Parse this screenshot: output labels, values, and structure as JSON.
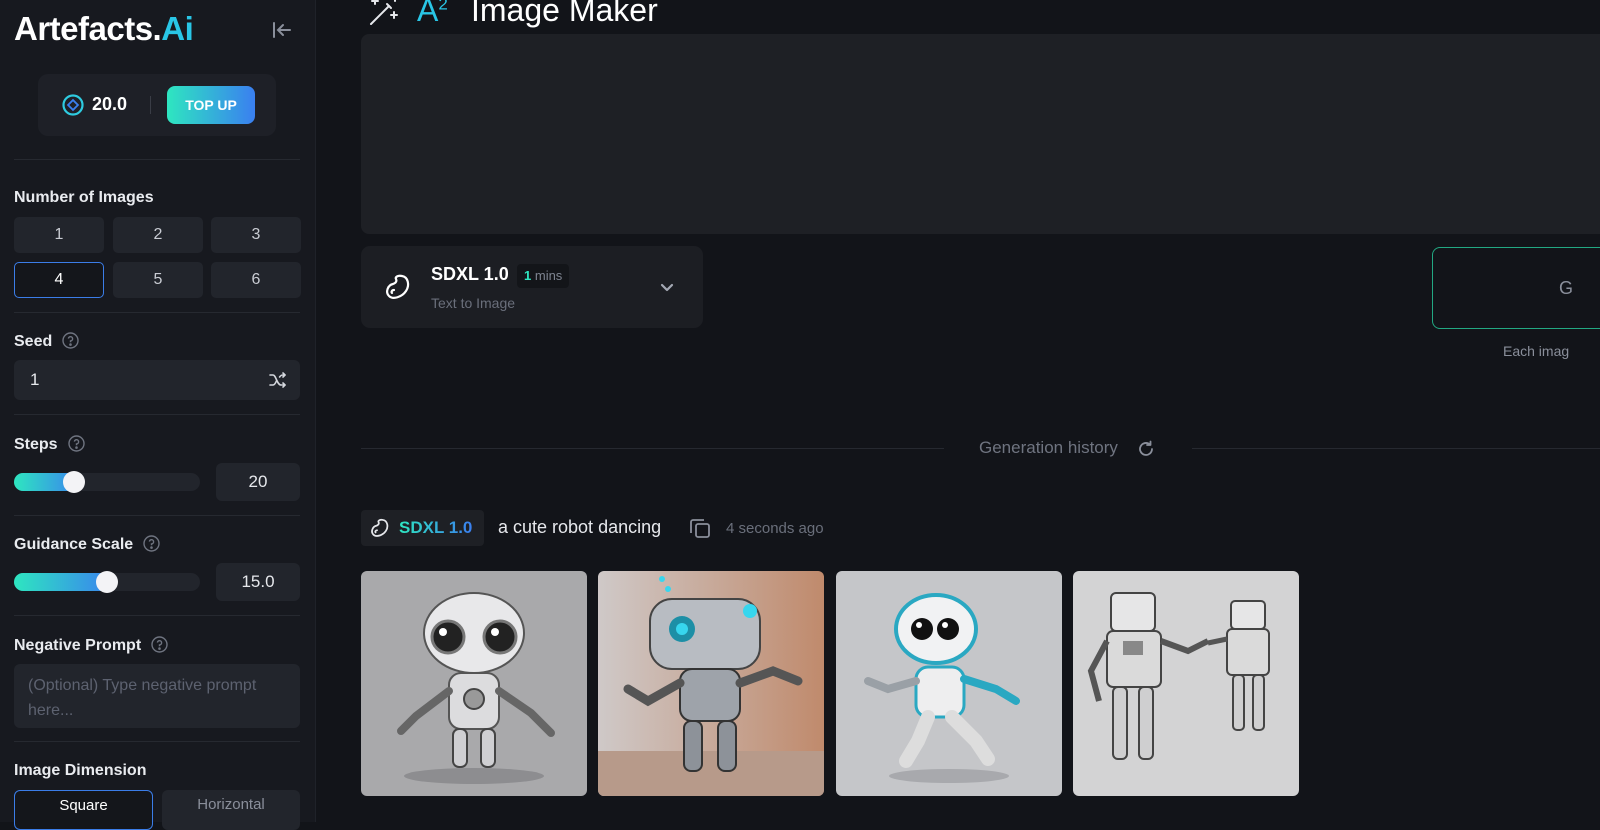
{
  "sidebar": {
    "logo_main": "Artefacts.",
    "logo_accent": "Ai",
    "credits": "20.0",
    "topup_label": "TOP UP",
    "num_images": {
      "label": "Number of Images",
      "options": [
        "1",
        "2",
        "3",
        "4",
        "5",
        "6"
      ],
      "selected": "4"
    },
    "seed": {
      "label": "Seed",
      "value": "1"
    },
    "steps": {
      "label": "Steps",
      "value": "20",
      "fraction": 0.32
    },
    "guidance": {
      "label": "Guidance Scale",
      "value": "15.0",
      "fraction": 0.5
    },
    "negative_prompt": {
      "label": "Negative Prompt",
      "placeholder": "(Optional) Type negative prompt here..."
    },
    "dimension": {
      "label": "Image Dimension",
      "options": [
        "Square",
        "Horizontal"
      ],
      "selected": "Square"
    }
  },
  "header": {
    "title_icon": "magic-wand-icon",
    "title_accent": "A",
    "title_sup": "2",
    "title": "Image Maker"
  },
  "model": {
    "name": "SDXL 1.0",
    "time_value": "1",
    "time_unit": "mins",
    "subtitle": "Text to Image"
  },
  "generate": {
    "label": "G",
    "note": "Each imag"
  },
  "history": {
    "label": "Generation history",
    "entry": {
      "model": "SDXL 1.0",
      "prompt": "a cute robot dancing",
      "time": "4 seconds ago"
    }
  },
  "colors": {
    "accent_teal": "#2ee6c0",
    "accent_blue": "#3a7ff0",
    "logo_ai": "#29c6e6",
    "bg_main": "#121419",
    "bg_sidebar": "#17191f"
  }
}
